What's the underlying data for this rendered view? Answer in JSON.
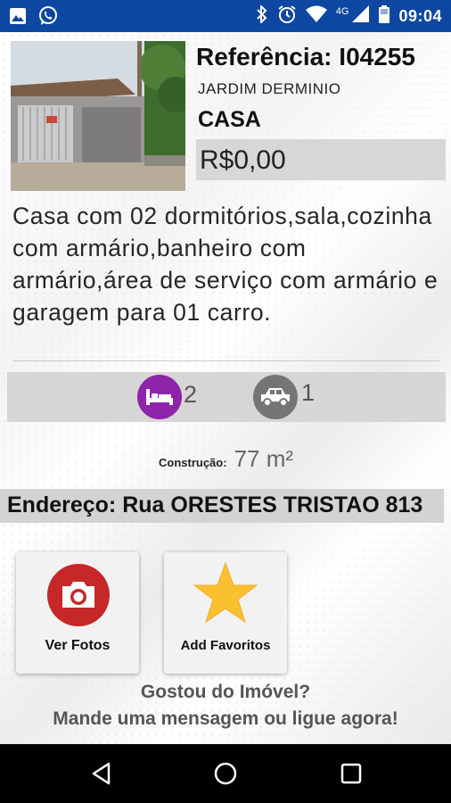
{
  "status_bar": {
    "time": "09:04",
    "network": "4G",
    "left_icons": [
      "image-icon",
      "whatsapp-icon"
    ],
    "right_icons": [
      "bluetooth-icon",
      "alarm-icon",
      "wifi-icon",
      "signal-icon",
      "battery-icon"
    ]
  },
  "property": {
    "reference": "Referência: I04255",
    "neighborhood": "JARDIM DERMINIO",
    "type": "CASA",
    "price": "R$0,00",
    "description": "Casa com 02 dormitórios,sala,cozinha com armário,banheiro com armário,área de serviço com armário e garagem para 01 carro.",
    "photo_icon": "house-photo"
  },
  "features": {
    "bedrooms": "2",
    "garage": "1",
    "bedroom_icon": "bed-icon",
    "garage_icon": "car-icon",
    "bedroom_color": "#8e24aa",
    "garage_color": "#757575"
  },
  "construction": {
    "label": "Construção:",
    "value": "77 m²"
  },
  "address": "Endereço: Rua ORESTES TRISTAO 813",
  "actions": {
    "photos_label": "Ver Fotos",
    "favorites_label": "Add Favoritos",
    "camera_color": "#c62828",
    "star_color": "#fbc02d"
  },
  "cta": {
    "line1": "Gostou do Imóvel?",
    "line2": "Mande uma mensagem ou ligue agora!"
  },
  "nav": [
    "back-icon",
    "home-icon",
    "recents-icon"
  ]
}
